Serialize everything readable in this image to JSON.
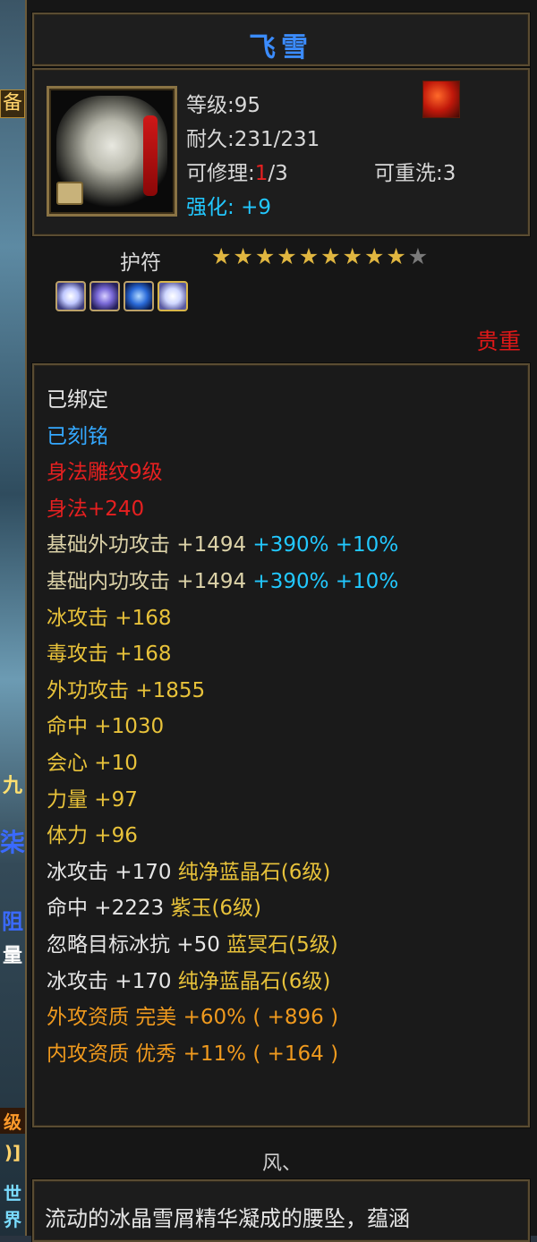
{
  "side": {
    "tab_text": "备",
    "glyph1": "九",
    "glyph2": "柒",
    "glyph3": "阻",
    "glyph4": "量",
    "glyph5": "级",
    "glyph6": ")]",
    "glyph7": "世界"
  },
  "item": {
    "name": "飞雪",
    "level_label": "等级",
    "level_value": ":95",
    "durability_label": "耐久",
    "durability_value": ":231/231",
    "repair_label": "可修理:",
    "repair_used": "1",
    "repair_total": "/3",
    "rewash_label": "可重洗",
    "rewash_value": ":3",
    "enhance_label": "强化:",
    "enhance_value": "+9",
    "type": "护符",
    "stars_total": 10,
    "stars_filled": 9,
    "rarity": "贵重",
    "gems": [
      "gem-icon",
      "gem-icon",
      "gem-icon",
      "gem-icon"
    ]
  },
  "attributes": [
    {
      "text": "已绑定",
      "color": "white"
    },
    {
      "text": "已刻铭",
      "color": "blue"
    },
    {
      "text": "身法雕纹9级",
      "color": "red"
    },
    {
      "text": "身法+240",
      "color": "red"
    },
    {
      "parts": [
        {
          "t": "基础外功攻击  +1494",
          "c": "beige"
        },
        {
          "t": " +390%",
          "c": "cyan"
        },
        {
          "t": " +10%",
          "c": "cyan"
        }
      ]
    },
    {
      "parts": [
        {
          "t": "基础内功攻击  +1494",
          "c": "beige"
        },
        {
          "t": " +390%",
          "c": "cyan"
        },
        {
          "t": " +10%",
          "c": "cyan"
        }
      ]
    },
    {
      "text": "冰攻击  +168",
      "color": "yellow"
    },
    {
      "text": "毒攻击  +168",
      "color": "yellow"
    },
    {
      "text": "外功攻击  +1855",
      "color": "yellow"
    },
    {
      "text": "命中  +1030",
      "color": "yellow"
    },
    {
      "text": "会心  +10",
      "color": "yellow"
    },
    {
      "text": "力量  +97",
      "color": "yellow"
    },
    {
      "text": "体力  +96",
      "color": "yellow"
    },
    {
      "parts": [
        {
          "t": "冰攻击  +170 ",
          "c": "white"
        },
        {
          "t": "纯净蓝晶石(6级)",
          "c": "yellow"
        }
      ]
    },
    {
      "parts": [
        {
          "t": "命中  +2223 ",
          "c": "white"
        },
        {
          "t": "紫玉(6级)",
          "c": "yellow"
        }
      ]
    },
    {
      "parts": [
        {
          "t": "忽略目标冰抗  +50 ",
          "c": "white"
        },
        {
          "t": "蓝冥石(5级)",
          "c": "yellow"
        }
      ]
    },
    {
      "parts": [
        {
          "t": "冰攻击  +170 ",
          "c": "white"
        },
        {
          "t": "纯净蓝晶石(6级)",
          "c": "yellow"
        }
      ]
    },
    {
      "text": "外攻资质   完美 +60% ( +896 )",
      "color": "orange"
    },
    {
      "text": "内攻资质   优秀 +11% ( +164 )",
      "color": "orange"
    }
  ],
  "footer": {
    "tag": "风、",
    "description": "流动的冰晶雪屑精华凝成的腰坠，蕴涵"
  }
}
